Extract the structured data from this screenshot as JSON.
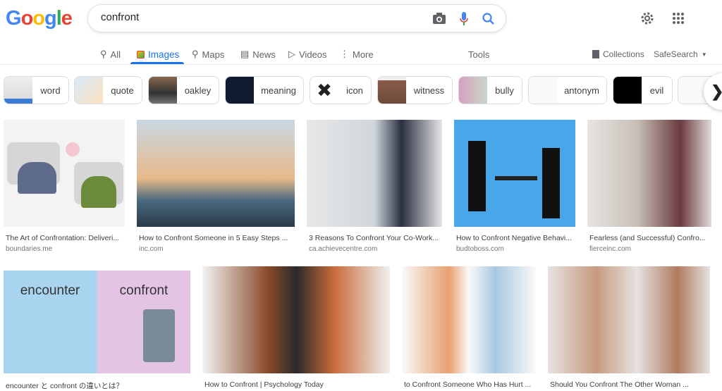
{
  "logo": "Google",
  "search": {
    "query": "confront"
  },
  "tabs": [
    {
      "label": "All",
      "icon": "search-icon"
    },
    {
      "label": "Images",
      "icon": "image-icon",
      "active": true
    },
    {
      "label": "Maps",
      "icon": "map-pin-icon"
    },
    {
      "label": "News",
      "icon": "news-icon"
    },
    {
      "label": "Videos",
      "icon": "play-icon"
    },
    {
      "label": "More",
      "icon": "more-vert-icon"
    }
  ],
  "tools": "Tools",
  "collections": "Collections",
  "safesearch": "SafeSearch",
  "chips": [
    "word",
    "quote",
    "oakley",
    "meaning",
    "icon",
    "witness",
    "bully",
    "antonym",
    "evil",
    ""
  ],
  "results": [
    {
      "title": "The Art of Confrontation: Deliveri...",
      "domain": "boundaries.me"
    },
    {
      "title": "How to Confront Someone in 5 Easy Steps ...",
      "domain": "inc.com"
    },
    {
      "title": "3 Reasons To Confront Your Co-Work...",
      "domain": "ca.achievecentre.com"
    },
    {
      "title": "How to Confront Negative Behavi...",
      "domain": "budtoboss.com"
    },
    {
      "title": "Fearless (and Successful) Confro...",
      "domain": "fierceinc.com"
    },
    {
      "title": "encounter と confront の違いとは？",
      "domain": "",
      "img_text": [
        "encounter",
        "confront"
      ]
    },
    {
      "title": "How to Confront | Psychology Today",
      "domain": ""
    },
    {
      "title": "to Confront Someone Who Has Hurt ...",
      "domain": ""
    },
    {
      "title": "Should You Confront The Other Woman ...",
      "domain": ""
    }
  ],
  "colors": {
    "accent": "#1a73e8"
  }
}
